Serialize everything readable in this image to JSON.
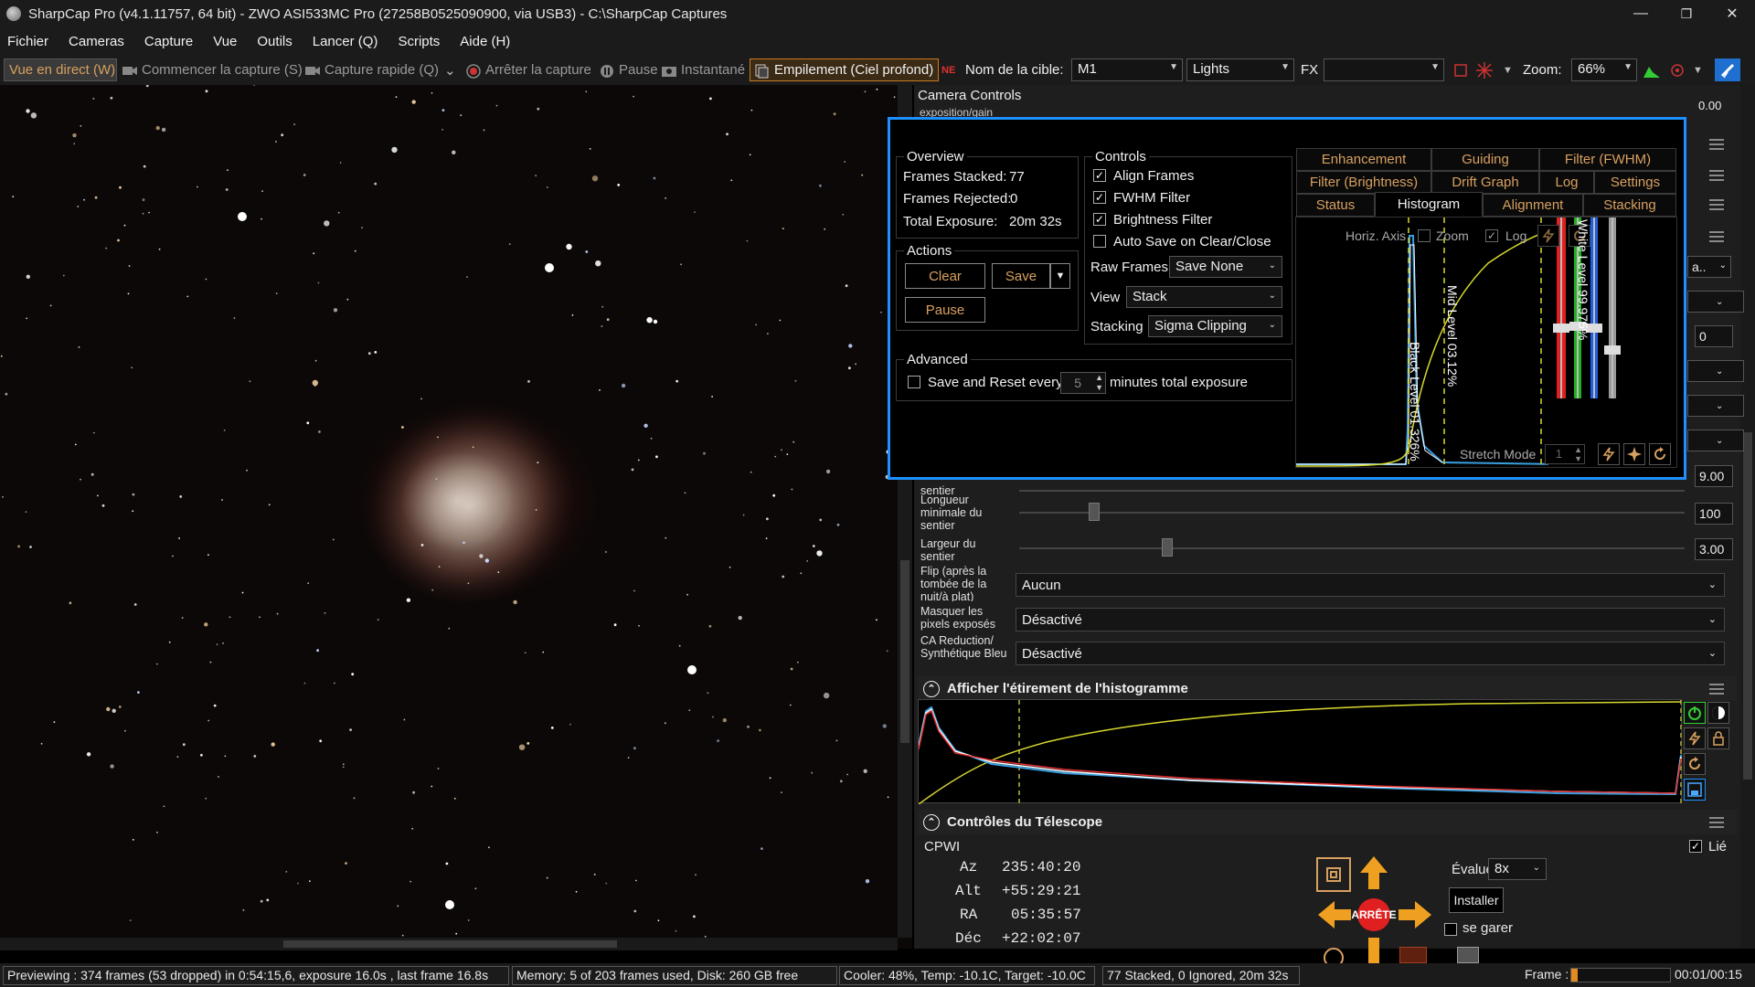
{
  "window": {
    "title": "SharpCap Pro (v4.1.11757, 64 bit) - ZWO ASI533MC Pro (27258B0525090900, via USB3) - C:\\SharpCap Captures",
    "minimize": "—",
    "maximize": "❐",
    "close": "✕"
  },
  "menu": [
    "Fichier",
    "Cameras",
    "Capture",
    "Vue",
    "Outils",
    "Lancer (Q)",
    "Scripts",
    "Aide (H)"
  ],
  "toolbar": {
    "live_view": "Vue en direct (W)",
    "start_capture": "Commencer la capture (S)",
    "quick_capture": "Capture rapide (Q)",
    "stop_capture": "Arrêter la capture",
    "pause": "Pause",
    "snapshot": "Instantané",
    "live_stack": "Empilement (Ciel profond)",
    "target_label": "Nom de la cible:",
    "target_value": "M1",
    "frame_type": "Lights",
    "fx_label": "FX",
    "fx_value": "",
    "zoom_label": "Zoom:",
    "zoom_value": "66%"
  },
  "camera_controls": {
    "title": "Camera Controls",
    "subtitle": "exposition/gain",
    "value_top": "0.00"
  },
  "live_stack": {
    "overview": {
      "title": "Overview",
      "frames_stacked_label": "Frames Stacked:",
      "frames_stacked": "77",
      "frames_rejected_label": "Frames Rejected:",
      "frames_rejected": "0",
      "total_exposure_label": "Total Exposure:",
      "total_exposure": "20m 32s"
    },
    "actions": {
      "title": "Actions",
      "clear": "Clear",
      "save": "Save",
      "pause": "Pause"
    },
    "advanced": {
      "title": "Advanced",
      "save_reset_label": "Save and Reset every",
      "save_reset_value": "5",
      "save_reset_suffix": "minutes total exposure"
    },
    "controls": {
      "title": "Controls",
      "align_frames": "Align Frames",
      "fwhm_filter": "FWHM Filter",
      "brightness_filter": "Brightness Filter",
      "auto_save": "Auto Save on Clear/Close",
      "raw_frames_label": "Raw Frames",
      "raw_frames_value": "Save None",
      "view_label": "View",
      "view_value": "Stack",
      "stacking_label": "Stacking",
      "stacking_value": "Sigma Clipping"
    },
    "tabs_row1": [
      "Enhancement",
      "Guiding",
      "Filter (FWHM)"
    ],
    "tabs_row2": [
      "Filter (Brightness)",
      "Drift Graph",
      "Log",
      "Settings"
    ],
    "tabs_row3": [
      "Status",
      "Histogram",
      "Alignment",
      "Stacking"
    ],
    "histogram": {
      "horiz_axis": "Horiz. Axis",
      "zoom": "Zoom",
      "log": "Log",
      "black_level": "Black Level  01.326%",
      "mid_level": "Mid Level  03.12%",
      "white_level": "White Level 99.975%",
      "stretch_mode": "Stretch Mode",
      "stretch_value": "1"
    }
  },
  "properties": {
    "path_label": "sentier",
    "value_900": "9.00",
    "min_length_label": "Longueur minimale du sentier",
    "min_length_value": "100",
    "width_label": "Largeur du sentier",
    "width_value": "3.00",
    "flip_label": "Flip (après la tombée de la nuit/à plat)",
    "flip_value": "Aucun",
    "mask_label": "Masquer les pixels exposés",
    "mask_value": "Désactivé",
    "ca_label": "CA Reduction/ Synthétique Bleu",
    "ca_value": "Désactivé",
    "side_value_a": "a..",
    "side_value_0": "0"
  },
  "stretch_panel": {
    "title": "Afficher l'étirement de l'histogramme"
  },
  "telescope": {
    "title": "Contrôles du Télescope",
    "mount": "CPWI",
    "linked": "Lié",
    "az_label": "Az",
    "az": "235:40:20",
    "alt_label": "Alt",
    "alt": "+55:29:21",
    "ra_label": "RA",
    "ra": "05:35:57",
    "dec_label": "Déc",
    "dec": "+22:02:07",
    "rate_label": "Évaluer:",
    "rate": "8x",
    "install": "Installer",
    "park": "se garer",
    "stop": "ARRÊTE"
  },
  "status": {
    "preview": "Previewing : 374 frames (53 dropped) in 0:54:15,6, exposure 16.0s , last frame 16.8s",
    "memory": "Memory: 5 of 203 frames used, Disk: 260 GB free",
    "cooler": "Cooler: 48%, Temp: -10.1C, Target: -10.0C",
    "stacked": "77 Stacked, 0 Ignored, 20m 32s",
    "frame_label": "Frame :",
    "time": "00:01/00:15"
  },
  "colors": {
    "accent": "#1e90ff",
    "orange": "#d8a060",
    "panel": "#1e1e1e"
  }
}
